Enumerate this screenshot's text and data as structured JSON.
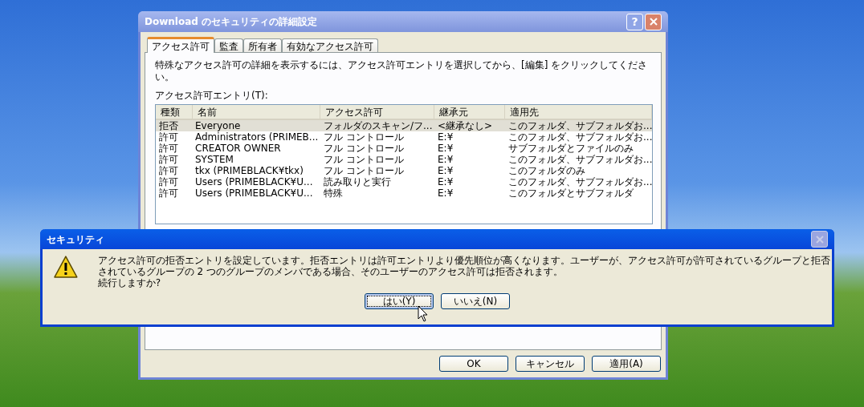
{
  "window": {
    "title": "Download のセキュリティの詳細設定",
    "help_button": "?"
  },
  "tabs": [
    {
      "label": "アクセス許可",
      "selected": true
    },
    {
      "label": "監査",
      "selected": false
    },
    {
      "label": "所有者",
      "selected": false
    },
    {
      "label": "有効なアクセス許可",
      "selected": false
    }
  ],
  "description": "特殊なアクセス許可の詳細を表示するには、アクセス許可エントリを選択してから、[編集] をクリックしてください。",
  "list_label": "アクセス許可エントリ(T):",
  "table": {
    "columns": [
      "種類",
      "名前",
      "アクセス許可",
      "継承元",
      "適用先"
    ],
    "rows": [
      {
        "cells": [
          "拒否",
          "Everyone",
          "フォルダのスキャン/フ...",
          "<継承なし>",
          "このフォルダ、サブフォルダお..."
        ],
        "selected": true
      },
      {
        "cells": [
          "許可",
          "Administrators (PRIMEB...",
          "フル コントロール",
          "E:¥",
          "このフォルダ、サブフォルダお..."
        ],
        "selected": false
      },
      {
        "cells": [
          "許可",
          "CREATOR OWNER",
          "フル コントロール",
          "E:¥",
          "サブフォルダとファイルのみ"
        ],
        "selected": false
      },
      {
        "cells": [
          "許可",
          "SYSTEM",
          "フル コントロール",
          "E:¥",
          "このフォルダ、サブフォルダお..."
        ],
        "selected": false
      },
      {
        "cells": [
          "許可",
          "tkx (PRIMEBLACK¥tkx)",
          "フル コントロール",
          "E:¥",
          "このフォルダのみ"
        ],
        "selected": false
      },
      {
        "cells": [
          "許可",
          "Users (PRIMEBLACK¥U...",
          "読み取りと実行",
          "E:¥",
          "このフォルダ、サブフォルダお..."
        ],
        "selected": false
      },
      {
        "cells": [
          "許可",
          "Users (PRIMEBLACK¥U...",
          "特殊",
          "E:¥",
          "このフォルダとサブフォルダ"
        ],
        "selected": false
      }
    ]
  },
  "buttons": [
    "OK",
    "キャンセル",
    "適用(A)"
  ],
  "alert": {
    "title": "セキュリティ",
    "message": "アクセス許可の拒否エントリを設定しています。拒否エントリは許可エントリより優先順位が高くなります。ユーザーが、アクセス許可が許可されているグループと拒否されているグループの 2 つのグループのメンバである場合、そのユーザーのアクセス許可は拒否されます。",
    "question": "続行しますか?",
    "buttons": [
      {
        "label": "はい(Y)",
        "focused": true
      },
      {
        "label": "いいえ(N)",
        "focused": false
      }
    ]
  }
}
